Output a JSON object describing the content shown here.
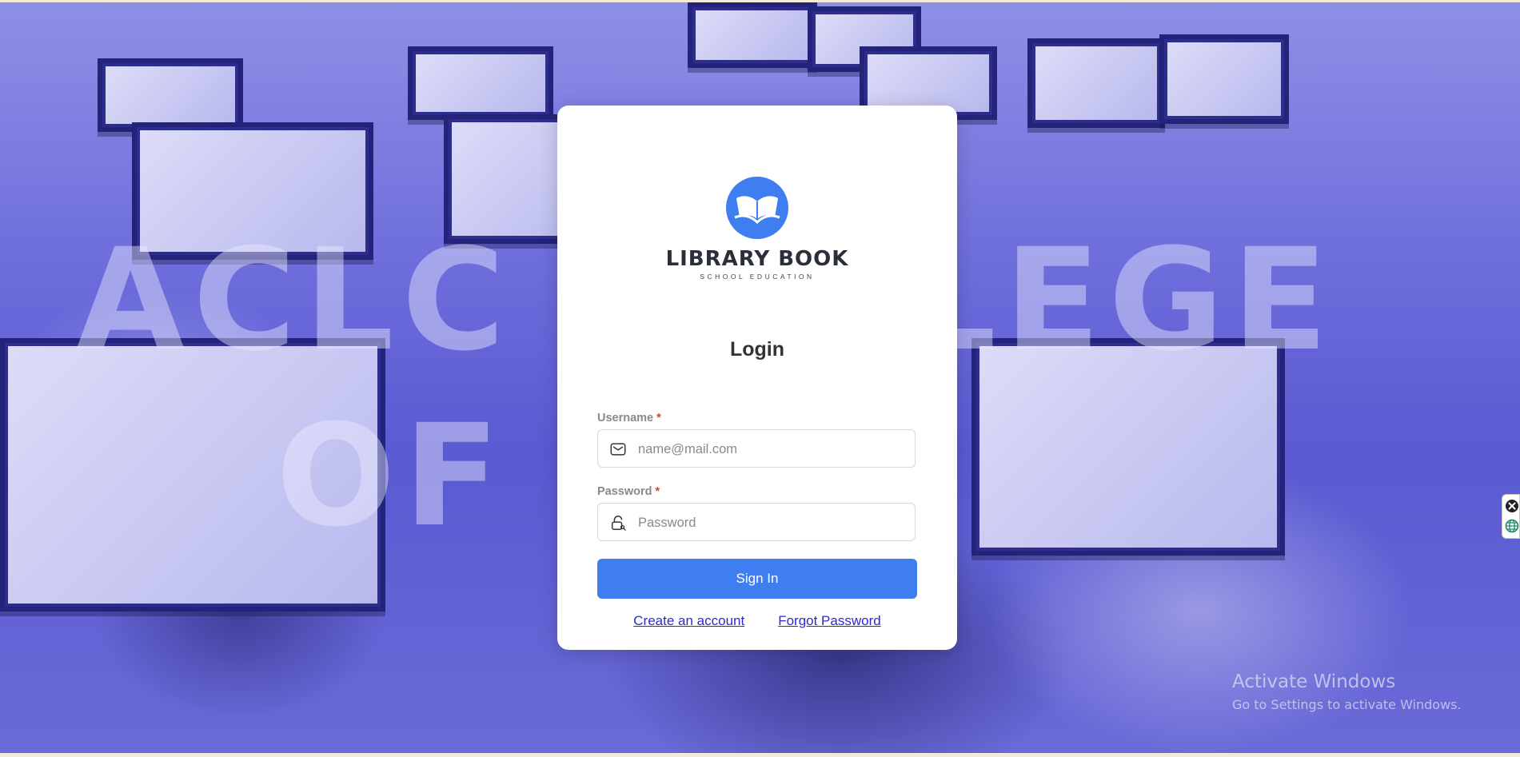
{
  "background": {
    "watermark_line1": "ACLC COLLEGE",
    "watermark_line2": "OF TAY"
  },
  "brand": {
    "name": "LIBRARY BOOK",
    "tagline": "SCHOOL EDUCATION",
    "accent_color": "#3f7ef0",
    "logo_icon": "open-book-icon"
  },
  "login": {
    "title": "Login",
    "username": {
      "label": "Username",
      "required_mark": "*",
      "placeholder": "name@mail.com",
      "value": "",
      "icon": "mail-icon"
    },
    "password": {
      "label": "Password",
      "required_mark": "*",
      "placeholder": "Password",
      "value": "",
      "icon": "lock-icon"
    },
    "submit_label": "Sign In",
    "create_account_label": "Create an account",
    "forgot_password_label": "Forgot Password"
  },
  "system": {
    "activate_title": "Activate Windows",
    "activate_subtitle": "Go to Settings to activate Windows."
  }
}
